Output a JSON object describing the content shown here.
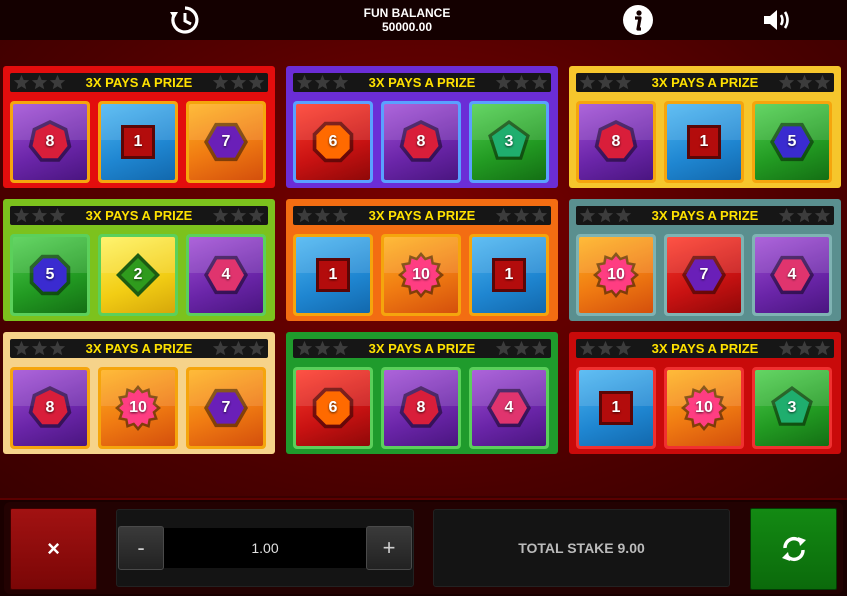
{
  "topbar": {
    "balance_label": "FUN BALANCE",
    "balance_value": "50000.00",
    "icons": [
      "history-icon",
      "info-icon",
      "sound-icon"
    ]
  },
  "cards": [
    {
      "title": "3X PAYS A PRIZE",
      "theme": "red",
      "frame": "#e30d0d",
      "tiles": [
        {
          "number": "8",
          "shape": "heptagon",
          "shape_color": "#d91e3a",
          "bg": "purple"
        },
        {
          "number": "1",
          "shape": "square",
          "shape_color": "#b30c0c",
          "bg": "blue"
        },
        {
          "number": "7",
          "shape": "hexagon",
          "shape_color": "#6a1fb8",
          "bg": "orange"
        }
      ]
    },
    {
      "title": "3X PAYS A PRIZE",
      "theme": "purple",
      "frame": "#6b2dd6",
      "tiles": [
        {
          "number": "6",
          "shape": "octagon",
          "shape_color": "#ff6a00",
          "bg": "red"
        },
        {
          "number": "8",
          "shape": "heptagon",
          "shape_color": "#d91e3a",
          "bg": "purple"
        },
        {
          "number": "3",
          "shape": "pentagon",
          "shape_color": "#1fae6e",
          "bg": "green"
        }
      ]
    },
    {
      "title": "3X PAYS A PRIZE",
      "theme": "yellow",
      "frame": "#f6c62c",
      "tiles": [
        {
          "number": "8",
          "shape": "heptagon",
          "shape_color": "#d91e3a",
          "bg": "purple"
        },
        {
          "number": "1",
          "shape": "square",
          "shape_color": "#b30c0c",
          "bg": "blue"
        },
        {
          "number": "5",
          "shape": "hexagon",
          "shape_color": "#3a2bd0",
          "bg": "green"
        }
      ]
    },
    {
      "title": "3X PAYS A PRIZE",
      "theme": "green",
      "frame": "#7cc21d",
      "tiles": [
        {
          "number": "5",
          "shape": "octagon",
          "shape_color": "#3a2bd0",
          "bg": "green"
        },
        {
          "number": "2",
          "shape": "diamond",
          "shape_color": "#2f9b1d",
          "bg": "yellow"
        },
        {
          "number": "4",
          "shape": "hexagon",
          "shape_color": "#e0346e",
          "bg": "purple"
        }
      ]
    },
    {
      "title": "3X PAYS A PRIZE",
      "theme": "orange",
      "frame": "#f36d12",
      "tiles": [
        {
          "number": "1",
          "shape": "square",
          "shape_color": "#b30c0c",
          "bg": "blue"
        },
        {
          "number": "10",
          "shape": "star",
          "shape_color": "#ff3d82",
          "bg": "orange"
        },
        {
          "number": "1",
          "shape": "square",
          "shape_color": "#b30c0c",
          "bg": "blue"
        }
      ]
    },
    {
      "title": "3X PAYS A PRIZE",
      "theme": "teal",
      "frame": "#5a8f8f",
      "tiles": [
        {
          "number": "10",
          "shape": "star",
          "shape_color": "#ff3d82",
          "bg": "orange"
        },
        {
          "number": "7",
          "shape": "hexagon",
          "shape_color": "#6a1fb8",
          "bg": "red"
        },
        {
          "number": "4",
          "shape": "hexagon",
          "shape_color": "#e0346e",
          "bg": "purple"
        }
      ]
    },
    {
      "title": "3X PAYS A PRIZE",
      "theme": "cream",
      "frame": "#f6d38a",
      "tiles": [
        {
          "number": "8",
          "shape": "heptagon",
          "shape_color": "#d91e3a",
          "bg": "purple"
        },
        {
          "number": "10",
          "shape": "star",
          "shape_color": "#ff3d82",
          "bg": "orange"
        },
        {
          "number": "7",
          "shape": "hexagon",
          "shape_color": "#6a1fb8",
          "bg": "orange"
        }
      ]
    },
    {
      "title": "3X PAYS A PRIZE",
      "theme": "darkgreen",
      "frame": "#1f9b2c",
      "tiles": [
        {
          "number": "6",
          "shape": "octagon",
          "shape_color": "#ff6a00",
          "bg": "red"
        },
        {
          "number": "8",
          "shape": "heptagon",
          "shape_color": "#d91e3a",
          "bg": "purple"
        },
        {
          "number": "4",
          "shape": "hexagon",
          "shape_color": "#e0346e",
          "bg": "purple"
        }
      ]
    },
    {
      "title": "3X PAYS A PRIZE",
      "theme": "darkred",
      "frame": "#c90a0a",
      "tiles": [
        {
          "number": "1",
          "shape": "square",
          "shape_color": "#b30c0c",
          "bg": "blue"
        },
        {
          "number": "10",
          "shape": "star",
          "shape_color": "#ff3d82",
          "bg": "orange"
        },
        {
          "number": "3",
          "shape": "pentagon",
          "shape_color": "#1fae6e",
          "bg": "green"
        }
      ]
    }
  ],
  "controls": {
    "cancel_label": "×",
    "minus_label": "-",
    "plus_label": "+",
    "stake_value": "1.00",
    "total_stake_label": "TOTAL STAKE 9.00"
  }
}
